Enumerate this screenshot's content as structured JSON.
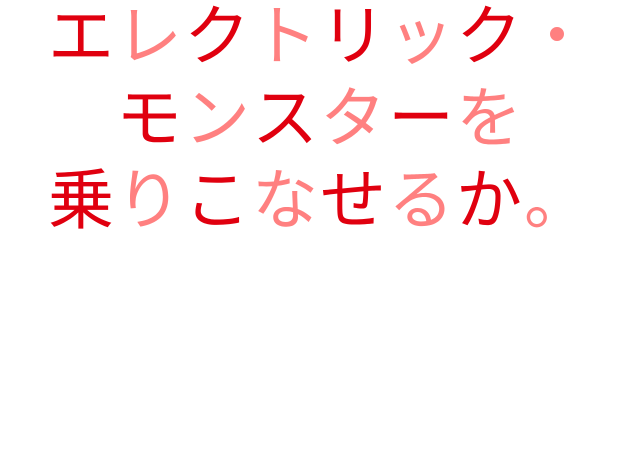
{
  "headline": {
    "lines": [
      [
        "エ",
        "レ",
        "ク",
        "ト",
        "リ",
        "ッ",
        "ク",
        "・"
      ],
      [
        "モ",
        "ン",
        "ス",
        "タ",
        "ー",
        "を"
      ],
      [
        "乗",
        "り",
        "こ",
        "な",
        "せ",
        "る",
        "か",
        "。"
      ]
    ],
    "colors": {
      "primary": "#e0000f",
      "secondary": "#ff8080"
    }
  }
}
